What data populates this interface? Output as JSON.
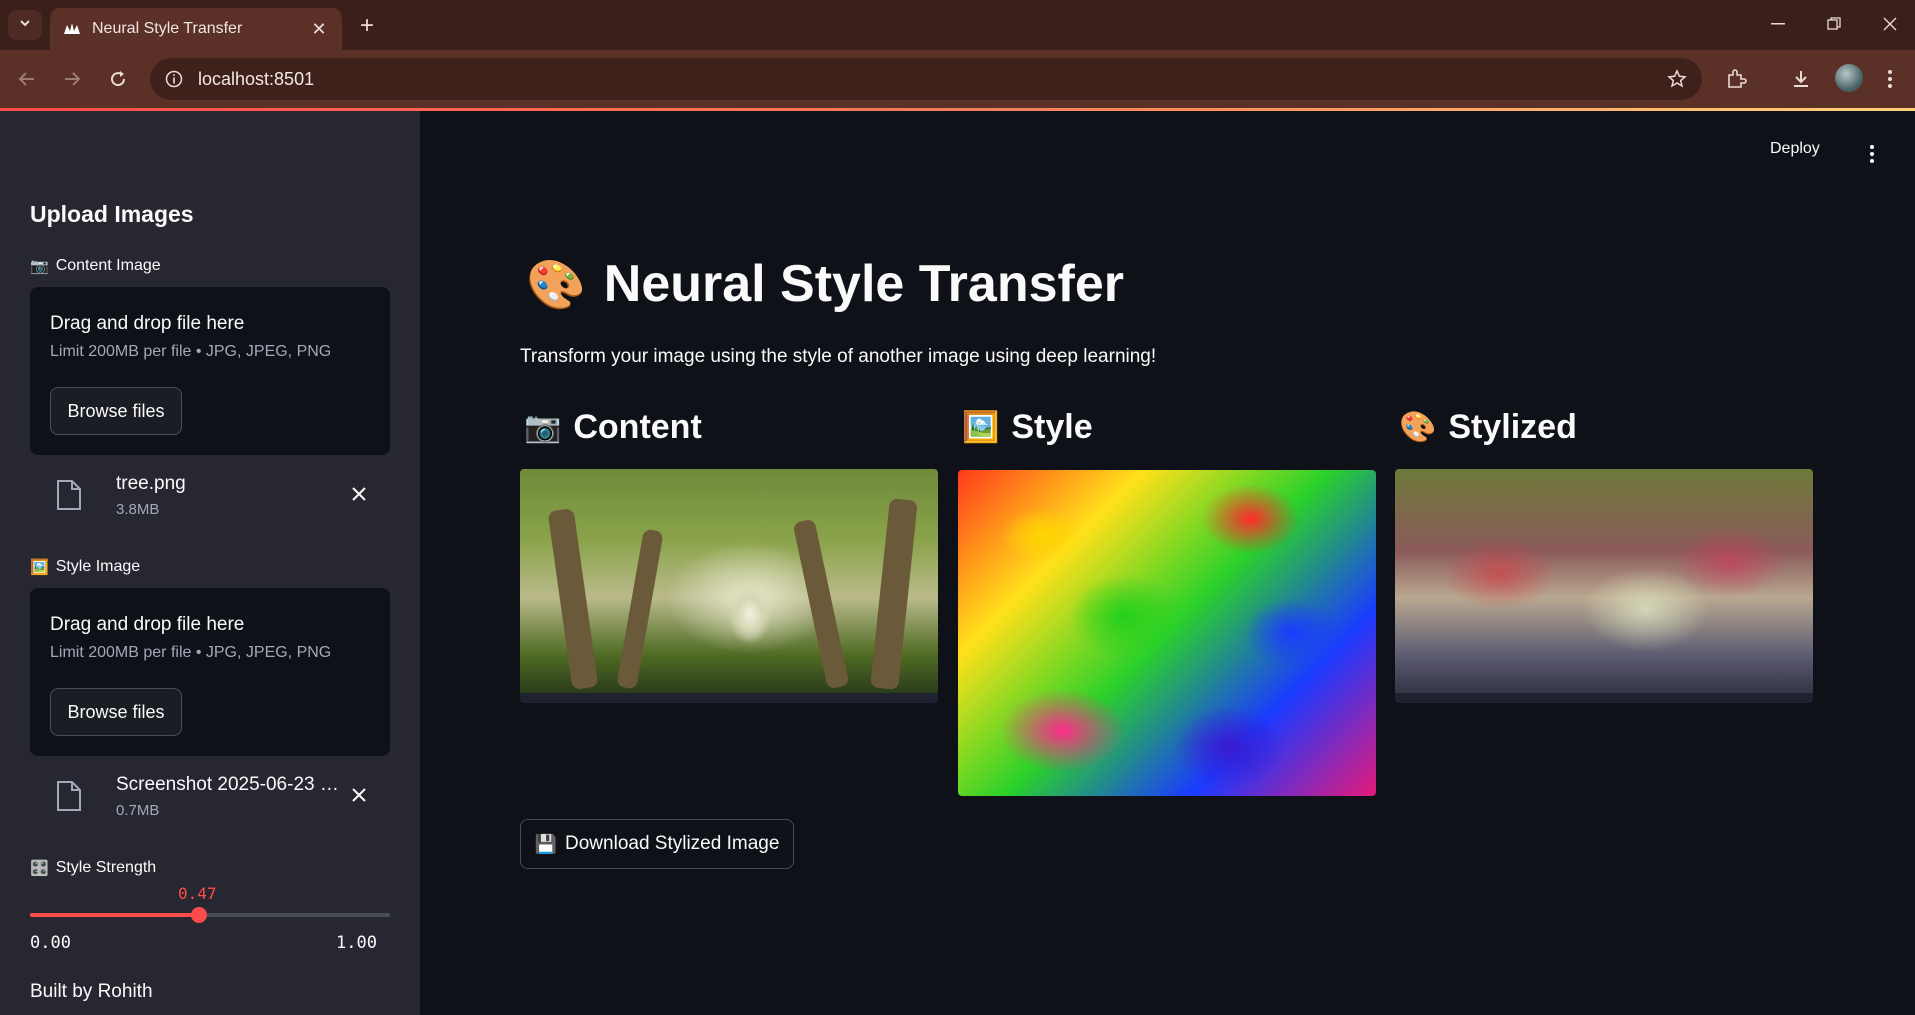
{
  "browser": {
    "tab_title": "Neural Style Transfer",
    "url": "localhost:8501"
  },
  "sidebar": {
    "title": "Upload Images",
    "content_label": "Content Image",
    "content_emoji": "📷",
    "style_label": "Style Image",
    "style_emoji": "🖼️",
    "dropzone_title": "Drag and drop file here",
    "dropzone_limit": "Limit 200MB per file • JPG, JPEG, PNG",
    "browse_label": "Browse files",
    "content_file": {
      "name": "tree.png",
      "size": "3.8MB"
    },
    "style_file": {
      "name": "Screenshot 2025-06-23 1...",
      "size": "0.7MB"
    },
    "strength_label": "Style Strength",
    "strength_emoji": "🎛️",
    "strength_value": "0.47",
    "strength_fraction": 0.47,
    "strength_min": "0.00",
    "strength_max": "1.00",
    "footer": "Built by Rohith"
  },
  "header": {
    "deploy_label": "Deploy"
  },
  "main": {
    "title_emoji": "🎨",
    "title": "Neural Style Transfer",
    "subtitle": "Transform your image using the style of another image using deep learning!",
    "columns": [
      {
        "emoji": "📷",
        "label": "Content"
      },
      {
        "emoji": "🖼️",
        "label": "Style"
      },
      {
        "emoji": "🎨",
        "label": "Stylized"
      }
    ],
    "download_emoji": "💾",
    "download_label": "Download Stylized Image"
  },
  "colors": {
    "accent": "#ff4b4b",
    "main_bg": "#0e1117",
    "sidebar_bg": "#262730",
    "browser_frame": "#5a3027"
  }
}
